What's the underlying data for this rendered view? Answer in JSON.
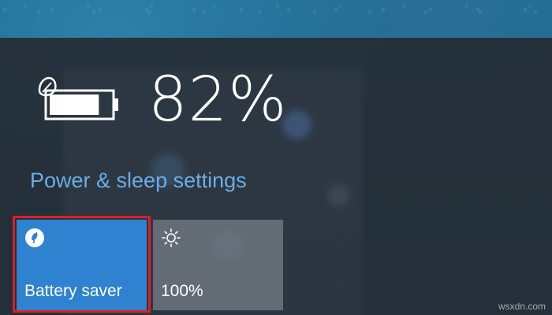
{
  "battery": {
    "percent_text": "82%",
    "level": 0.82,
    "icon": "battery-leaf-icon"
  },
  "settings_link": {
    "label": "Power & sleep settings"
  },
  "quick_actions": [
    {
      "id": "battery-saver",
      "label": "Battery saver",
      "icon": "leaf-icon",
      "active": true
    },
    {
      "id": "brightness",
      "label": "100%",
      "icon": "sun-icon",
      "active": false
    }
  ],
  "colors": {
    "accent": "#2e82cf",
    "link": "#6aaee6",
    "highlight": "#e01e24",
    "panel": "#262c34"
  },
  "watermark": "wsxdn.com"
}
